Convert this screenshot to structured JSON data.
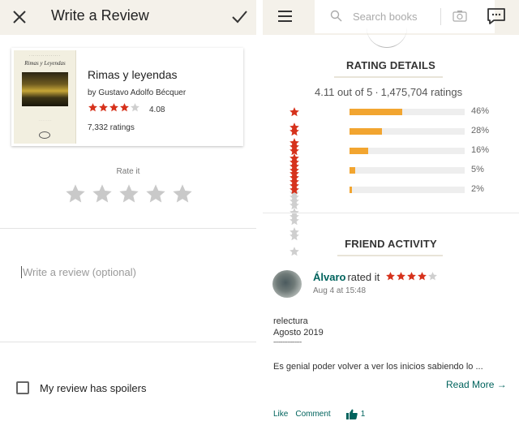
{
  "colors": {
    "header_bg": "#f4f1ea",
    "star_red": "#d6321c",
    "star_grey": "#cfcfcf",
    "bar_orange": "#f2a530",
    "link_green": "#00635d"
  },
  "review_screen": {
    "header": {
      "close_icon": "close-icon",
      "title": "Write a Review",
      "confirm_icon": "check-icon"
    },
    "book": {
      "cover_title": "Rimas y Leyendas",
      "title": "Rimas y leyendas",
      "author": "by Gustavo Adolfo Bécquer",
      "average": "4.08",
      "rating_stars": 4,
      "ratings_count": "7,332 ratings"
    },
    "rate_label": "Rate it",
    "rate_stars": 5,
    "review_placeholder": "Write a review (optional)",
    "spoiler_label": "My review has spoilers",
    "spoiler_checked": false
  },
  "book_screen": {
    "header": {
      "menu_icon": "hamburger-menu-icon",
      "search_placeholder": "Search books",
      "camera_icon": "camera-icon",
      "chat_icon": "chat-icon"
    },
    "rating_details": {
      "heading": "RATING DETAILS",
      "summary_avg": "4.11 out of 5",
      "summary_sep": "·",
      "summary_count": "1,475,704 ratings",
      "distribution": [
        {
          "stars": 5,
          "percent": 46,
          "label": "46%"
        },
        {
          "stars": 4,
          "percent": 28,
          "label": "28%"
        },
        {
          "stars": 3,
          "percent": 16,
          "label": "16%"
        },
        {
          "stars": 2,
          "percent": 5,
          "label": "5%"
        },
        {
          "stars": 1,
          "percent": 2,
          "label": "2%"
        }
      ]
    },
    "friend_activity": {
      "heading": "FRIEND ACTIVITY",
      "user": "Álvaro",
      "action": "rated it",
      "stars": 4,
      "date": "Aug 4 at 15:48",
      "review_line1": "relectura",
      "review_line2": "Agosto 2019",
      "review_line3": "----------------",
      "review_text": "Es genial poder volver a ver los inicios sabiendo lo ...",
      "read_more": "Read More",
      "read_more_arrow": "→",
      "like_label": "Like",
      "comment_label": "Comment",
      "like_count": "1"
    }
  }
}
